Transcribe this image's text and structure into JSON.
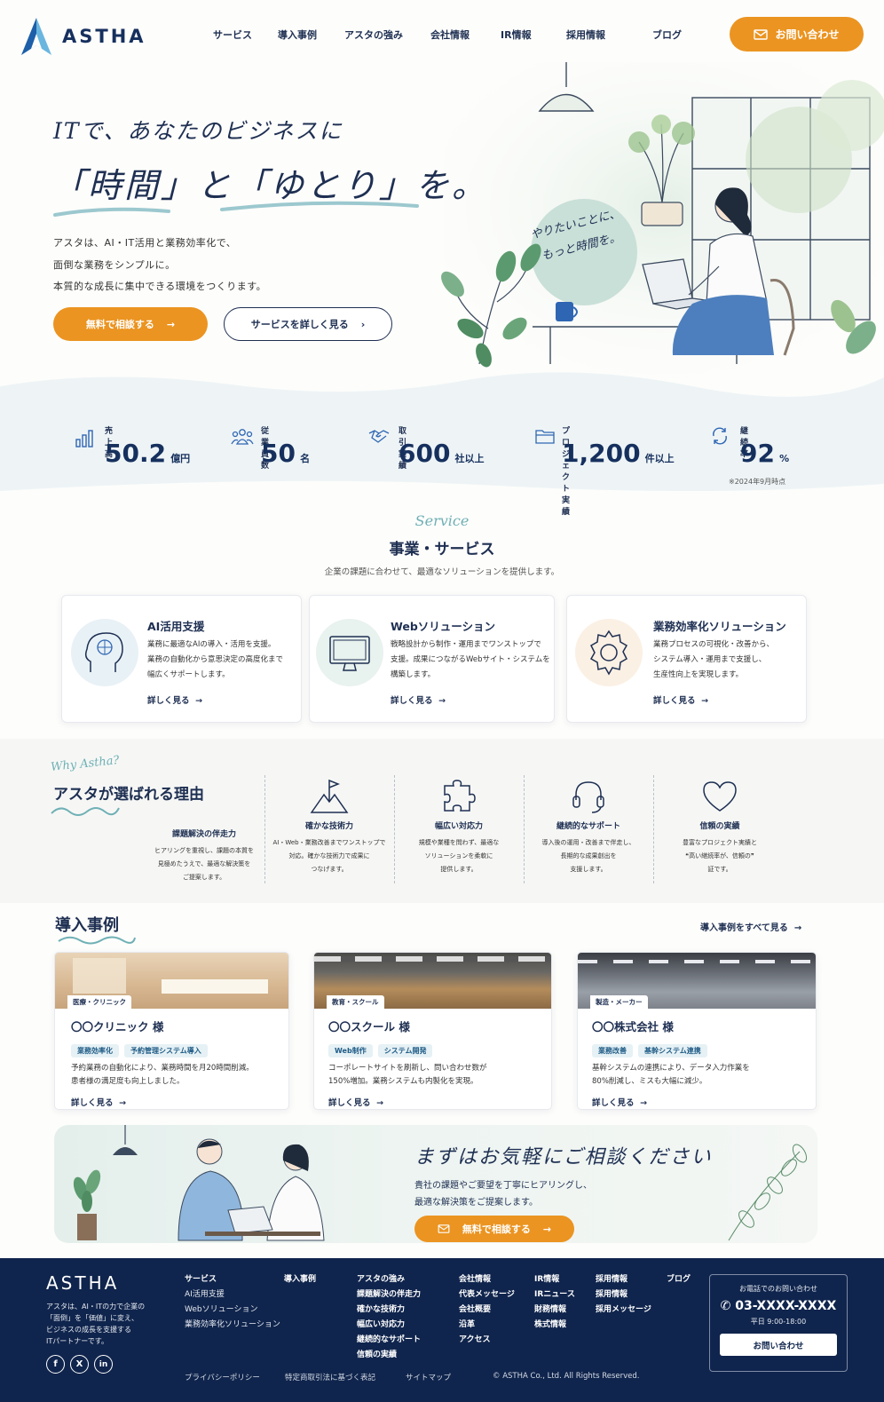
{
  "header": {
    "logo_text": "ASTHA",
    "nav": [
      "サービス",
      "導入事例",
      "アスタの強み",
      "会社情報",
      "IR情報",
      "採用情報",
      "ブログ"
    ],
    "contact_button": "お問い合わせ"
  },
  "hero": {
    "line1": "ITで、あなたのビジネスに",
    "line2": "「時間」と「ゆとり」を。",
    "paragraph": [
      "アスタは、AI・IT活用と業務効率化で、",
      "面倒な業務をシンプルに。",
      "本質的な成長に集中できる環境をつくります。"
    ],
    "primary_button": "無料で相談する",
    "secondary_button": "サービスを詳しく見る",
    "bubble": [
      "やりたいことに、",
      "もっと時間を。"
    ]
  },
  "stats": {
    "items": [
      {
        "label": "売上高",
        "value": "50.2",
        "unit": "億円",
        "icon": "bar-chart-icon"
      },
      {
        "label": "従業員数",
        "value": "50",
        "unit": "名",
        "icon": "people-icon"
      },
      {
        "label": "取引実績",
        "value": "600",
        "unit": "社以上",
        "icon": "handshake-icon"
      },
      {
        "label": "プロジェクト実績",
        "value": "1,200",
        "unit": "件以上",
        "icon": "folder-icon"
      },
      {
        "label": "継続率",
        "value": "92",
        "unit": "%",
        "icon": "cycle-icon"
      }
    ],
    "note": "※2024年9月時点"
  },
  "services": {
    "script": "Service",
    "title": "事業・サービス",
    "subtitle": "企業の課題に合わせて、最適なソリューションを提供します。",
    "items": [
      {
        "title": "AI活用支援",
        "desc": [
          "業務に最適なAIの導入・活用を支援。",
          "業務の自動化から意思決定の高度化まで",
          "幅広くサポートします。"
        ],
        "link": "詳しく見る",
        "icon": "ai-head-icon"
      },
      {
        "title": "Webソリューション",
        "desc": [
          "戦略設計から制作・運用までワンストップで",
          "支援。成果につながるWebサイト・システムを",
          "構築します。"
        ],
        "link": "詳しく見る",
        "icon": "monitor-icon"
      },
      {
        "title": "業務効率化ソリューション",
        "desc": [
          "業務プロセスの可視化・改善から、",
          "システム導入・運用まで支援し、",
          "生産性向上を実現します。"
        ],
        "link": "詳しく見る",
        "icon": "gear-icon"
      }
    ]
  },
  "reasons": {
    "script": "Why Astha?",
    "title": "アスタが選ばれる理由",
    "items": [
      {
        "title": "課題解決の伴走力",
        "desc": [
          "ヒアリングを重視し、課題の本質を",
          "見極めたうえで、最適な解決策を",
          "ご提案します。"
        ],
        "icon": ""
      },
      {
        "title": "確かな技術力",
        "desc": [
          "AI・Web・業務改善までワンストップで",
          "対応。確かな技術力で成果に",
          "つなげます。"
        ],
        "icon": "flag-mountain-icon"
      },
      {
        "title": "幅広い対応力",
        "desc": [
          "規模や業種を問わず、最適な",
          "ソリューションを柔軟に",
          "提供します。"
        ],
        "icon": "puzzle-icon"
      },
      {
        "title": "継続的なサポート",
        "desc": [
          "導入後の運用・改善まで伴走し、",
          "長期的な成果創出を",
          "支援します。"
        ],
        "icon": "headset-icon"
      },
      {
        "title": "信頼の実績",
        "desc": [
          "豊富なプロジェクト実績と",
          "❝高い継続率が、信頼の❞",
          "証です。"
        ],
        "icon": "heart-icon"
      }
    ]
  },
  "cases": {
    "title": "導入事例",
    "all_link": "導入事例をすべて見る",
    "items": [
      {
        "category": "医療・クリニック",
        "name": "〇〇クリニック 様",
        "tags": [
          "業務効率化",
          "予約管理システム導入"
        ],
        "desc": [
          "予約業務の自動化により、業務時間を月20時間削減。",
          "患者様の満足度も向上しました。"
        ],
        "link": "詳しく見る"
      },
      {
        "category": "教育・スクール",
        "name": "〇〇スクール 様",
        "tags": [
          "Web制作",
          "システム開発"
        ],
        "desc": [
          "コーポレートサイトを刷新し、問い合わせ数が",
          "150%増加。業務システムも内製化を実現。"
        ],
        "link": "詳しく見る"
      },
      {
        "category": "製造・メーカー",
        "name": "〇〇株式会社 様",
        "tags": [
          "業務改善",
          "基幹システム連携"
        ],
        "desc": [
          "基幹システムの連携により、データ入力作業を",
          "80%削減し、ミスも大幅に減少。"
        ],
        "link": "詳しく見る"
      }
    ]
  },
  "cta": {
    "title": "まずはお気軽にご相談ください",
    "desc": [
      "貴社の課題やご要望を丁寧にヒアリングし、",
      "最適な解決策をご提案します。"
    ],
    "button": "無料で相談する"
  },
  "footer": {
    "logo": "ASTHA",
    "about": [
      "アスタは、AI・ITの力で企業の",
      "「面倒」を「価値」に変え、",
      "ビジネスの成長を支援する",
      "ITパートナーです。"
    ],
    "col_service": {
      "head": "サービス",
      "items": [
        "AI活用支援",
        "Webソリューション",
        "業務効率化ソリューション"
      ]
    },
    "col_cases": {
      "head": "導入事例"
    },
    "col_strength": {
      "head": "アスタの強み",
      "items": [
        "課題解決の伴走力",
        "確かな技術力",
        "幅広い対応力",
        "継続的なサポート",
        "信頼の実績"
      ]
    },
    "col_company": {
      "head": "会社情報",
      "items": [
        "代表メッセージ",
        "会社概要",
        "沿革",
        "アクセス"
      ]
    },
    "col_ir": {
      "head": "IR情報",
      "items": [
        "IRニュース",
        "財務情報",
        "株式情報"
      ]
    },
    "col_recruit": {
      "head": "採用情報",
      "items": [
        "採用情報",
        "採用メッセージ"
      ]
    },
    "col_blog": {
      "head": "ブログ"
    },
    "contact": {
      "title": "お電話でのお問い合わせ",
      "phone": "03-XXXX-XXXX",
      "hours": "平日 9:00-18:00",
      "button": "お問い合わせ"
    },
    "bottom": [
      "プライバシーポリシー",
      "特定商取引法に基づく表記",
      "サイトマップ",
      "© ASTHA Co., Ltd. All Rights Reserved."
    ]
  },
  "colors": {
    "navy": "#16305e",
    "orange": "#eb9421",
    "teal": "#6fb0b5",
    "footer": "#10254d"
  }
}
